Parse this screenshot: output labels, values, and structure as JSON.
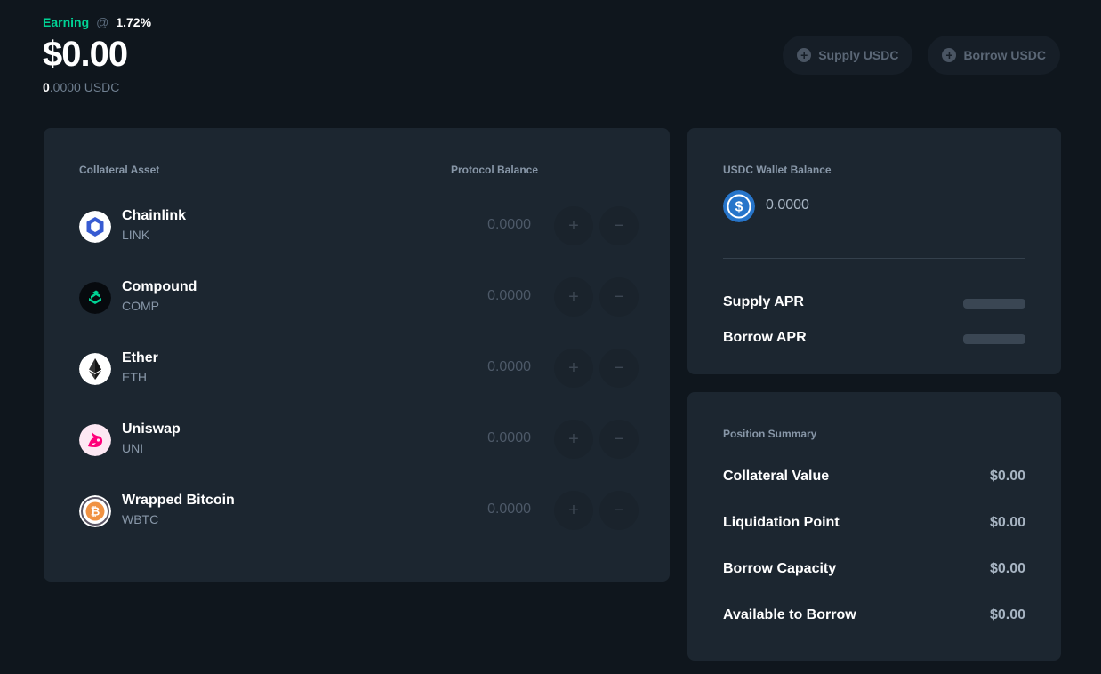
{
  "header": {
    "earning_label": "Earning",
    "at_symbol": "@",
    "earning_rate": "1.72%",
    "balance_usd": "$0.00",
    "balance_lead": "0",
    "balance_rest": ".0000 USDC"
  },
  "actions": {
    "supply_label": "Supply USDC",
    "borrow_label": "Borrow USDC"
  },
  "assets_table": {
    "col_asset": "Collateral Asset",
    "col_balance": "Protocol Balance",
    "plus_glyph": "+",
    "minus_glyph": "−",
    "rows": [
      {
        "name": "Chainlink",
        "ticker": "LINK",
        "balance": "0.0000"
      },
      {
        "name": "Compound",
        "ticker": "COMP",
        "balance": "0.0000"
      },
      {
        "name": "Ether",
        "ticker": "ETH",
        "balance": "0.0000"
      },
      {
        "name": "Uniswap",
        "ticker": "UNI",
        "balance": "0.0000"
      },
      {
        "name": "Wrapped Bitcoin",
        "ticker": "WBTC",
        "balance": "0.0000"
      }
    ]
  },
  "wallet": {
    "label": "USDC Wallet Balance",
    "value": "0.0000",
    "supply_apr_label": "Supply APR",
    "borrow_apr_label": "Borrow APR"
  },
  "summary": {
    "title": "Position Summary",
    "items": [
      {
        "label": "Collateral Value",
        "value": "$0.00"
      },
      {
        "label": "Liquidation Point",
        "value": "$0.00"
      },
      {
        "label": "Borrow Capacity",
        "value": "$0.00"
      },
      {
        "label": "Available to Borrow",
        "value": "$0.00"
      }
    ]
  },
  "colors": {
    "accent_green": "#00d395",
    "background": "#0f161d",
    "card": "#1c2630"
  },
  "icons": [
    "chainlink-icon",
    "compound-icon",
    "ether-icon",
    "uniswap-icon",
    "bitcoin-icon",
    "usdc-icon",
    "plus-circle-icon"
  ]
}
